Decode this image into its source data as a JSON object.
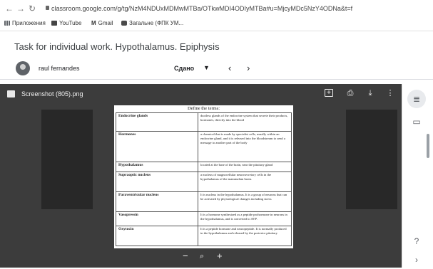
{
  "browser": {
    "url": "classroom.google.com/g/tg/NzM4NDUxMDMwMTBa/OTkwMDI4ODIyMTBa#u=MjcyMDc5NzY4ODNa&t=f",
    "bookmarks": [
      "Приложения",
      "YouTube",
      "Gmail",
      "Загальне (ФПК УМ..."
    ]
  },
  "assignment": {
    "title": "Task for individual work. Hypothalamus. Epiphysis"
  },
  "student": {
    "name": "raul fernandes",
    "status": "Сдано"
  },
  "viewer": {
    "file_name": "Screenshot (805).png"
  },
  "document": {
    "heading": "Define the terms:",
    "rows": [
      {
        "term": "Endocrine glands",
        "definition": "ductless glands of the endocrine system that secrete their products, hormones, directly into the blood"
      },
      {
        "term": "Hormones",
        "definition": "a chemical that is made by specialist cells, usually within an endocrine gland, and it is released into the bloodstream to send a message to another part of the body"
      },
      {
        "term": "Hypothalamus",
        "definition": "located at the base of the brain, near the pituitary gland"
      },
      {
        "term": "Supraoptic nucleus",
        "definition": "a nucleus of magnocellular neurosecretory cells in the hypothalamus of the mammalian brain."
      },
      {
        "term": "Paraventricular nucleus",
        "definition": "It is nucleus in the hypothalamus. It is a group of neurons that can be activated by physiological changes including stress"
      },
      {
        "term": "Vasopressin",
        "definition": "It is a hormone synthesized as a peptide prohormone in neurons in the hypothalamus, and is converted to AVP."
      },
      {
        "term": "Oxytocin",
        "definition": "It is a peptide hormone and neuropeptide. It is normally produced in the hypothalamus and released by the posterior pituitary"
      }
    ]
  },
  "icons": {
    "nav": [
      "back-icon",
      "forward-icon",
      "reload-icon",
      "lock-icon"
    ],
    "viewer": [
      "file-image-icon",
      "open-in-new-icon",
      "print-icon",
      "download-icon",
      "more-vert-icon",
      "zoom-out-icon",
      "zoom-reset-icon",
      "zoom-in-icon"
    ],
    "rail": [
      "details-icon",
      "comment-icon",
      "help-icon",
      "chevron-right-icon"
    ]
  }
}
